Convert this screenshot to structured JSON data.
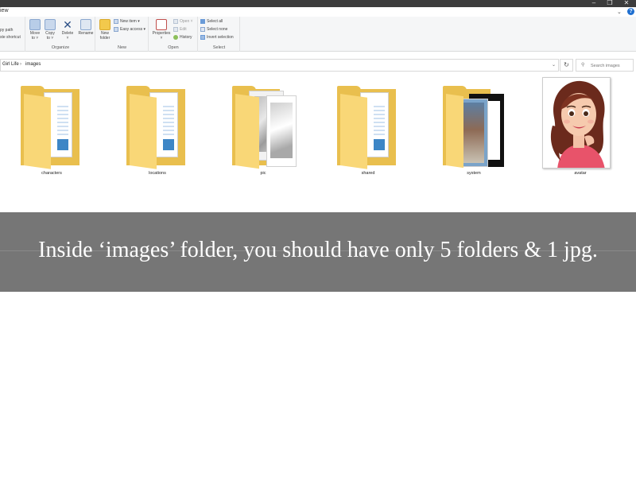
{
  "titlebar": {
    "minimize": "–",
    "maximize": "❐",
    "close": "✕"
  },
  "ribbon_tabs": {
    "view": "iew",
    "collapse": "⌄",
    "help": "?"
  },
  "ribbon": {
    "clipboard": {
      "copy_path": "py path",
      "paste_shortcut": "ste shortcut"
    },
    "organize": {
      "label": "Organize",
      "move_to": "Move",
      "move_to_sub": "to ˅",
      "copy_to": "Copy",
      "copy_to_sub": "to ˅",
      "delete": "Delete",
      "delete_sub": "˅",
      "rename": "Rename"
    },
    "new": {
      "label": "New",
      "new_folder": "New",
      "new_folder_sub": "folder",
      "new_item": "New item ▾",
      "easy_access": "Easy access ▾"
    },
    "open": {
      "label": "Open",
      "properties": "Properties",
      "properties_sub": "˅",
      "open": "Open ˅",
      "edit": "Edit",
      "history": "History"
    },
    "select": {
      "label": "Select",
      "select_all": "Select all",
      "select_none": "Select none",
      "invert_selection": "Invert selection"
    }
  },
  "address": {
    "crumbs": [
      "Girl Life",
      "images"
    ],
    "separator": "›",
    "dropdown": "⌄",
    "refresh": "↻",
    "search_placeholder": "Search images",
    "search_icon": "search-icon"
  },
  "items": [
    {
      "name": "characters",
      "type": "folder"
    },
    {
      "name": "locations",
      "type": "folder"
    },
    {
      "name": "pic",
      "type": "folder"
    },
    {
      "name": "shared",
      "type": "folder"
    },
    {
      "name": "system",
      "type": "folder"
    },
    {
      "name": "avatar",
      "type": "jpg"
    }
  ],
  "colors": {
    "folder_back": "#e9bf4e",
    "folder_front": "#f9d777",
    "banner": "#767676",
    "accent": "#1f6fd0"
  },
  "caption": "Inside ‘images’ folder, you should have only 5 folders & 1 jpg."
}
